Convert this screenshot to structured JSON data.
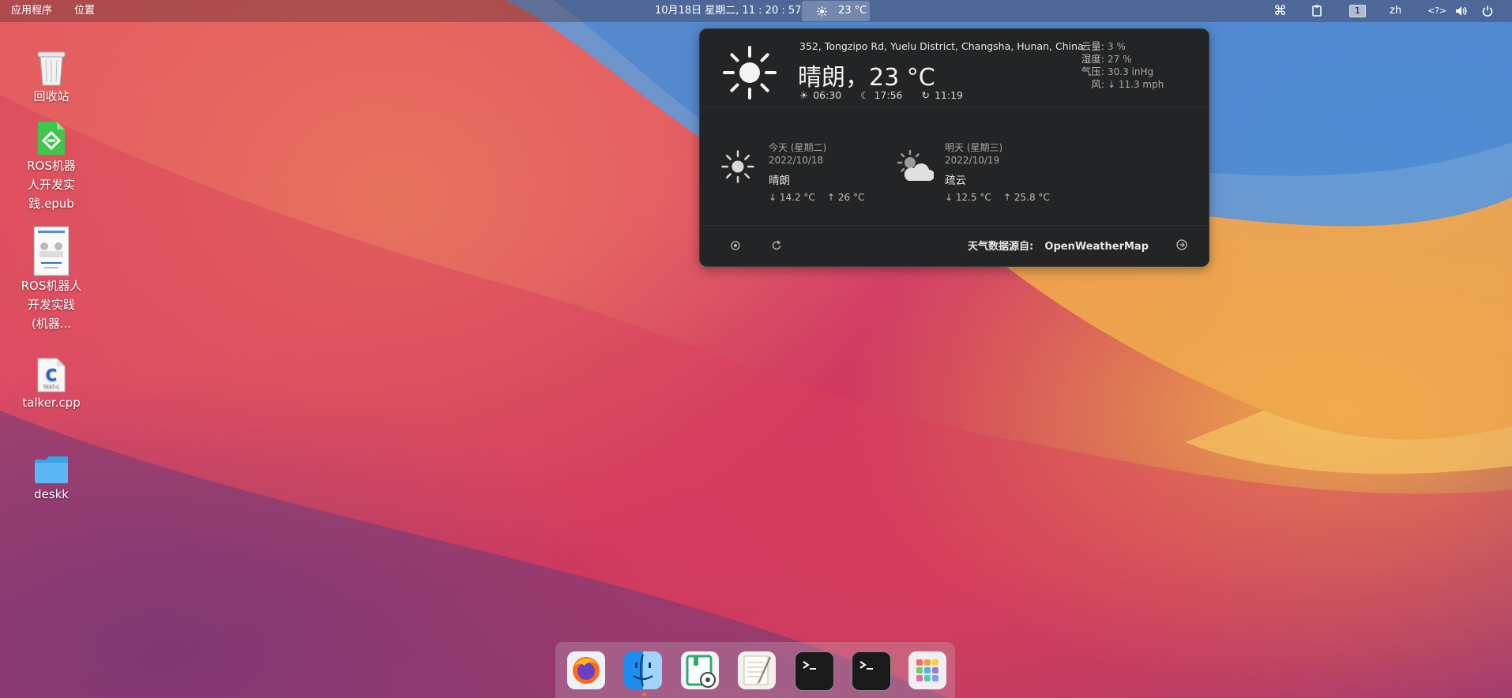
{
  "topbar": {
    "apps_menu": "应用程序",
    "places_menu": "位置",
    "clock": "10月18日 星期二, 11 : 20 : 57",
    "weather_temp": "23 °C",
    "workspace": "1",
    "lang": "zh"
  },
  "weather": {
    "location": "352, Tongzipo Rd, Yuelu District, Changsha, Hunan, China",
    "current": "晴朗，23 °C",
    "sunrise": "06:30",
    "sunset": "17:56",
    "updated": "11:19",
    "labels": {
      "cloud": "云量:",
      "humidity": "湿度:",
      "pressure": "气压:",
      "wind": "风:"
    },
    "values": {
      "cloud": "3 %",
      "humidity": "27 %",
      "pressure": "30.3 inHg",
      "wind": "↓ 11.3 mph"
    },
    "forecast": [
      {
        "day": "今天 (星期二)",
        "date": "2022/10/18",
        "cond": "晴朗",
        "low": "↓ 14.2 °C",
        "high": "↑ 26 °C",
        "icon": "sun-icon"
      },
      {
        "day": "明天 (星期三)",
        "date": "2022/10/19",
        "cond": "疏云",
        "low": "↓ 12.5 °C",
        "high": "↑ 25.8 °C",
        "icon": "partly-cloudy-icon"
      }
    ],
    "source_label": "天气数据源自:",
    "source": "OpenWeatherMap"
  },
  "desktop": {
    "trash": "回收站",
    "epub": "ROS机器人开发实践.epub",
    "pdf": "ROS机器人开发实践 (机器...",
    "cpp": "talker.cpp",
    "cpp_badge": "TEXT-C",
    "folder": "deskk"
  },
  "dock": [
    "firefox",
    "finder",
    "document-viewer",
    "text-editor",
    "terminal",
    "terminal",
    "app-grid"
  ]
}
